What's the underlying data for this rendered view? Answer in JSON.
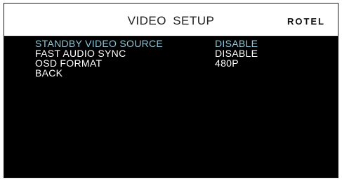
{
  "header": {
    "title": "VIDEO SETUP",
    "logo": "ROTEL"
  },
  "menu": {
    "items": [
      {
        "label": "STANDBY VIDEO SOURCE",
        "value": "DISABLE",
        "selected": true
      },
      {
        "label": "FAST AUDIO SYNC",
        "value": "DISABLE",
        "selected": false
      },
      {
        "label": "OSD FORMAT",
        "value": "480P",
        "selected": false
      },
      {
        "label": "BACK",
        "value": "",
        "selected": false
      }
    ]
  },
  "colors": {
    "background": "#000000",
    "header_background": "#ffffff",
    "text": "#ffffff",
    "highlight": "#8fc7d8"
  }
}
